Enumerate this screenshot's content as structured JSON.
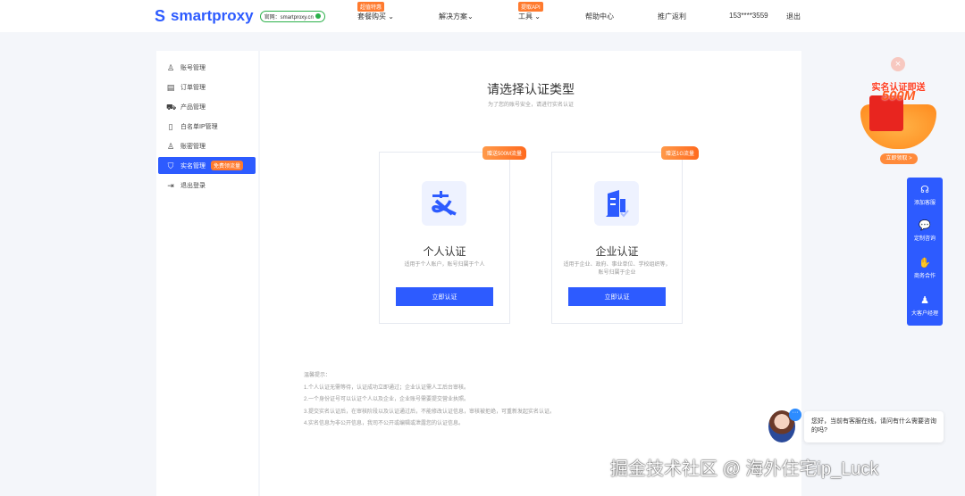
{
  "header": {
    "logo": "smartproxy",
    "official": "官网：smartproxy.cn",
    "nav": [
      {
        "label": "套餐购买",
        "badge": "超值特惠",
        "chev": true
      },
      {
        "label": "解决方案",
        "chev": true
      },
      {
        "label": "工具",
        "badge": "提取API",
        "chev": true
      },
      {
        "label": "帮助中心"
      },
      {
        "label": "推广返利"
      },
      {
        "label": "153****3559"
      },
      {
        "label": "退出"
      }
    ]
  },
  "sidebar": {
    "items": [
      {
        "label": "账号管理",
        "icon": "user-icon"
      },
      {
        "label": "订单管理",
        "icon": "order-icon"
      },
      {
        "label": "产品管理",
        "icon": "cart-icon"
      },
      {
        "label": "白名单IP管理",
        "icon": "file-icon"
      },
      {
        "label": "账密管理",
        "icon": "user-key-icon"
      },
      {
        "label": "实名管理",
        "icon": "shield-icon",
        "tag": "免费领流量",
        "active": true
      },
      {
        "label": "退出登录",
        "icon": "logout-icon"
      }
    ]
  },
  "main": {
    "title": "请选择认证类型",
    "subtitle": "为了您的账号安全，请进行实名认证",
    "cards": [
      {
        "tag": "赠送500M流量",
        "name": "个人认证",
        "desc": "适用于个人账户，账号归属于个人",
        "button": "立即认证"
      },
      {
        "tag": "赠送1G流量",
        "name": "企业认证",
        "desc": "适用于企业、政府、事业单位、学校组织等，账号归属于企业",
        "button": "立即认证"
      }
    ],
    "tips": {
      "title": "温馨提示：",
      "items": [
        "1.个人认证无需等待，认证成功立即通过；企业认证需人工后台审核。",
        "2.一个身份证号可以认证个人以及企业，企业账号需要提交营业执照。",
        "3.提交实名认证后，在审核阶段以及认证通过后，不能修改认证信息，审核被拒绝，可重新发起实名认证。",
        "4.实名信息为非公开信息，我司不公开或编辑或泄露您的认证信息。"
      ]
    }
  },
  "promo": {
    "title": "实名认证即送",
    "amount": "500M",
    "button": "立即领取 >"
  },
  "float": {
    "items": [
      "添加客服",
      "定制咨询",
      "商务合作",
      "大客户经理"
    ]
  },
  "chat": {
    "message": "您好，当前有客服在线，请问有什么需要咨询的吗?"
  },
  "watermark": "掘金技术社区 @ 海外住宅ip_Luck",
  "colors": {
    "primary": "#2d5bff",
    "accent": "#ff7a2e"
  }
}
